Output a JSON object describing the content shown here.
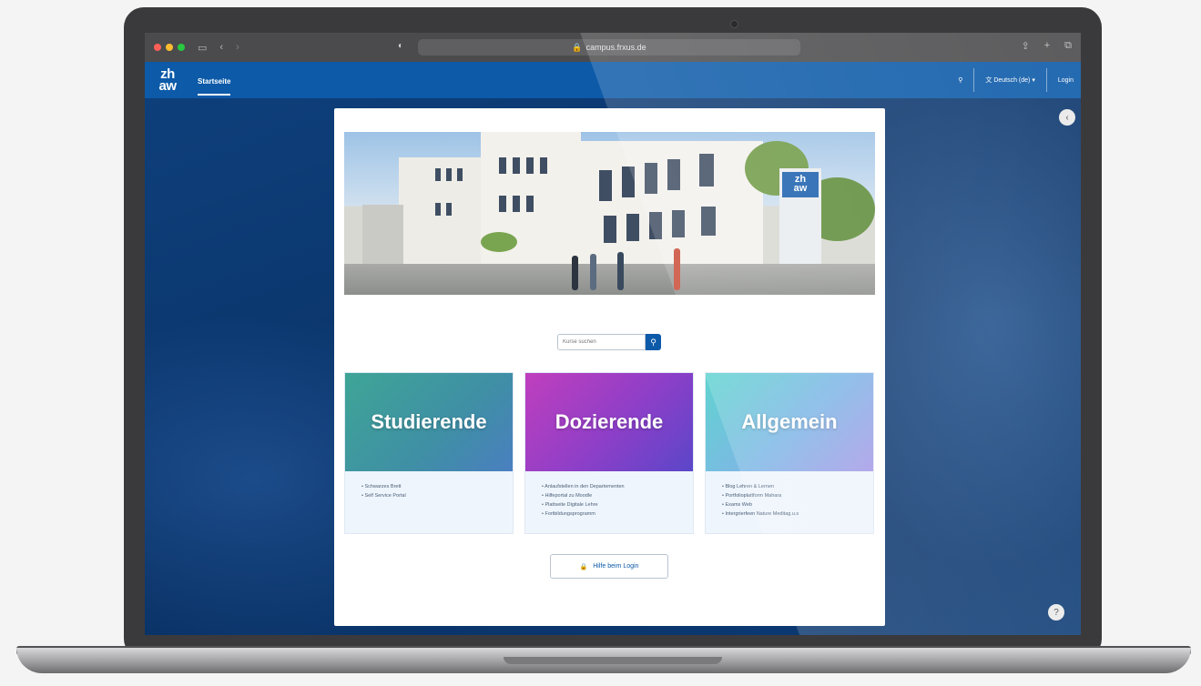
{
  "browser": {
    "url": "campus.frxus.de",
    "traffic_colors": [
      "#ff5f57",
      "#febc2e",
      "#28c840"
    ]
  },
  "site": {
    "logo_line1": "zh",
    "logo_line2": "aw",
    "nav_home": "Startseite",
    "language": "Deutsch (de)",
    "login": "Login"
  },
  "search": {
    "placeholder": "Kurse suchen"
  },
  "tiles": [
    {
      "title": "Studierende",
      "items": [
        "Schwarzes Brett",
        "Self Service Portal"
      ]
    },
    {
      "title": "Dozierende",
      "items": [
        "Anlaufstellen in den Departementen",
        "Hilfeportal zu Moodle",
        "Plattseite Digitale Lehre",
        "Fortbildungsprogramm"
      ]
    },
    {
      "title": "Allgemein",
      "items": [
        "Blog Lehren & Lernen",
        "Portfolioplattform Mahara",
        "Exams Web",
        "Intergrierfeen Nature Meditag.u.s"
      ]
    }
  ],
  "help": {
    "label": "Hilfe beim Login"
  },
  "colors": {
    "brand": "#0c5aa8",
    "tile1": "#3fa596",
    "tile2": "#a23fc4",
    "tile3": "#6fd0d8"
  }
}
